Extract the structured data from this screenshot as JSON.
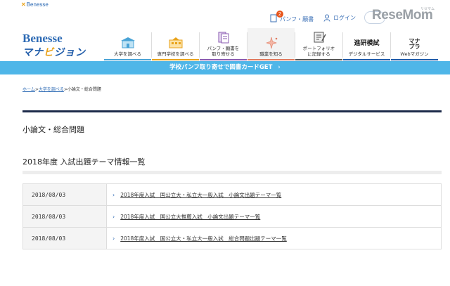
{
  "header": {
    "corp_logo": "Benesse",
    "brand_line1": "Benesse",
    "brand_line2_a": "マナ",
    "brand_line2_b": "ビ",
    "brand_line2_c": "ジョン",
    "pamphlet_label": "パンフ・願書",
    "pamphlet_count": "2",
    "login_label": "ログイン",
    "watermark": "ReseMom",
    "watermark_sub": "リセマム"
  },
  "nav": {
    "items": [
      {
        "label": "大学を調べる",
        "icon": "university-building-icon"
      },
      {
        "label": "専門学校を調べる",
        "icon": "school-building-icon"
      },
      {
        "label": "パンフ・願書を\n取り寄せる",
        "icon": "pamphlet-icon"
      },
      {
        "label": "職業を知る",
        "icon": "sparkle-icon"
      },
      {
        "label": "ポートフォリオ\nに記録する",
        "icon": "portfolio-icon"
      },
      {
        "label": "デジタルサービス",
        "icon_text": "進研模試"
      },
      {
        "label": "Webマガジン",
        "icon_text": "マナ\nプラ"
      }
    ]
  },
  "banner": {
    "text": "学校パンフ取り寄せで図書カードGET",
    "arrow": "›"
  },
  "breadcrumb": {
    "home": "ホーム",
    "sep": ">",
    "parent": "大学を調べる",
    "current": "小論文・総合問題"
  },
  "page": {
    "title": "小論文・総合問題",
    "section_title": "2018年度 入試出題テーマ情報一覧"
  },
  "table": {
    "rows": [
      {
        "date": "2018/08/03",
        "text": "2018年度入試　国公立大・私立大一般入試　小論文出題テーマ一覧"
      },
      {
        "date": "2018/08/03",
        "text": "2018年度入試　国公立大推薦入試　小論文出題テーマ一覧"
      },
      {
        "date": "2018/08/03",
        "text": "2018年度入試　国公立大・私立大一般入試　総合問題出題テーマ一覧"
      }
    ]
  },
  "colors": {
    "brand_blue": "#2d6ab4",
    "banner_blue": "#4fb6e8",
    "badge_orange": "#e8541a",
    "rule_navy": "#1d2b4a"
  }
}
